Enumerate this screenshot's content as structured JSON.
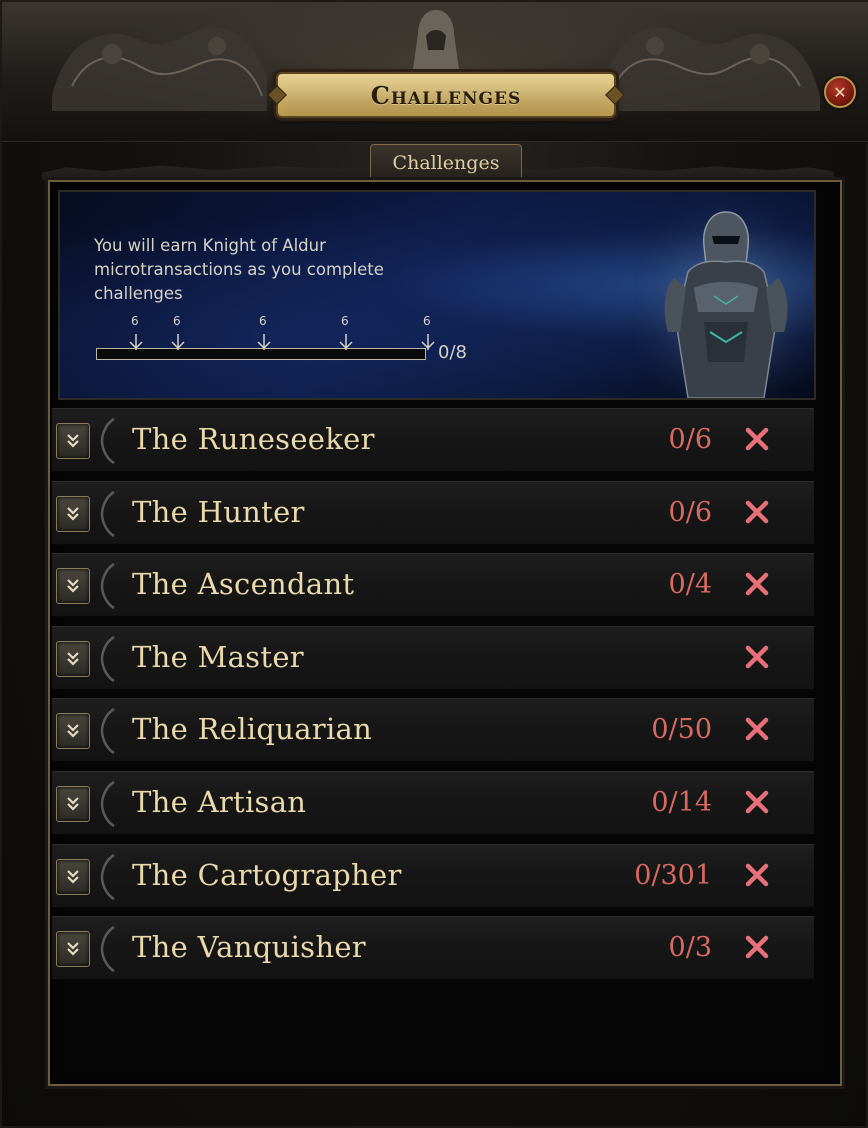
{
  "window": {
    "title": "Challenges",
    "close_glyph": "✕"
  },
  "tabs": [
    {
      "label": "Challenges",
      "active": true
    }
  ],
  "banner": {
    "text": "You will earn Knight of Aldur microtransactions as you complete challenges",
    "milestone_labels": [
      "6",
      "6",
      "6",
      "6",
      "6"
    ],
    "progress_text": "0/8",
    "progress_fraction": 0
  },
  "challenges": [
    {
      "name": "The Runeseeker",
      "progress": "0/6"
    },
    {
      "name": "The Hunter",
      "progress": "0/6"
    },
    {
      "name": "The Ascendant",
      "progress": "0/4"
    },
    {
      "name": "The Master",
      "progress": ""
    },
    {
      "name": "The Reliquarian",
      "progress": "0/50"
    },
    {
      "name": "The Artisan",
      "progress": "0/14"
    },
    {
      "name": "The Cartographer",
      "progress": "0/301"
    },
    {
      "name": "The Vanquisher",
      "progress": "0/3"
    }
  ],
  "icons": {
    "expand": "chevron-down-icon",
    "status": "red-x-icon",
    "close": "close-icon"
  },
  "colors": {
    "title_plate": "#cdb574",
    "name_text": "#ead9ac",
    "progress_text": "#d96a60",
    "status_x": "#e8707a"
  }
}
